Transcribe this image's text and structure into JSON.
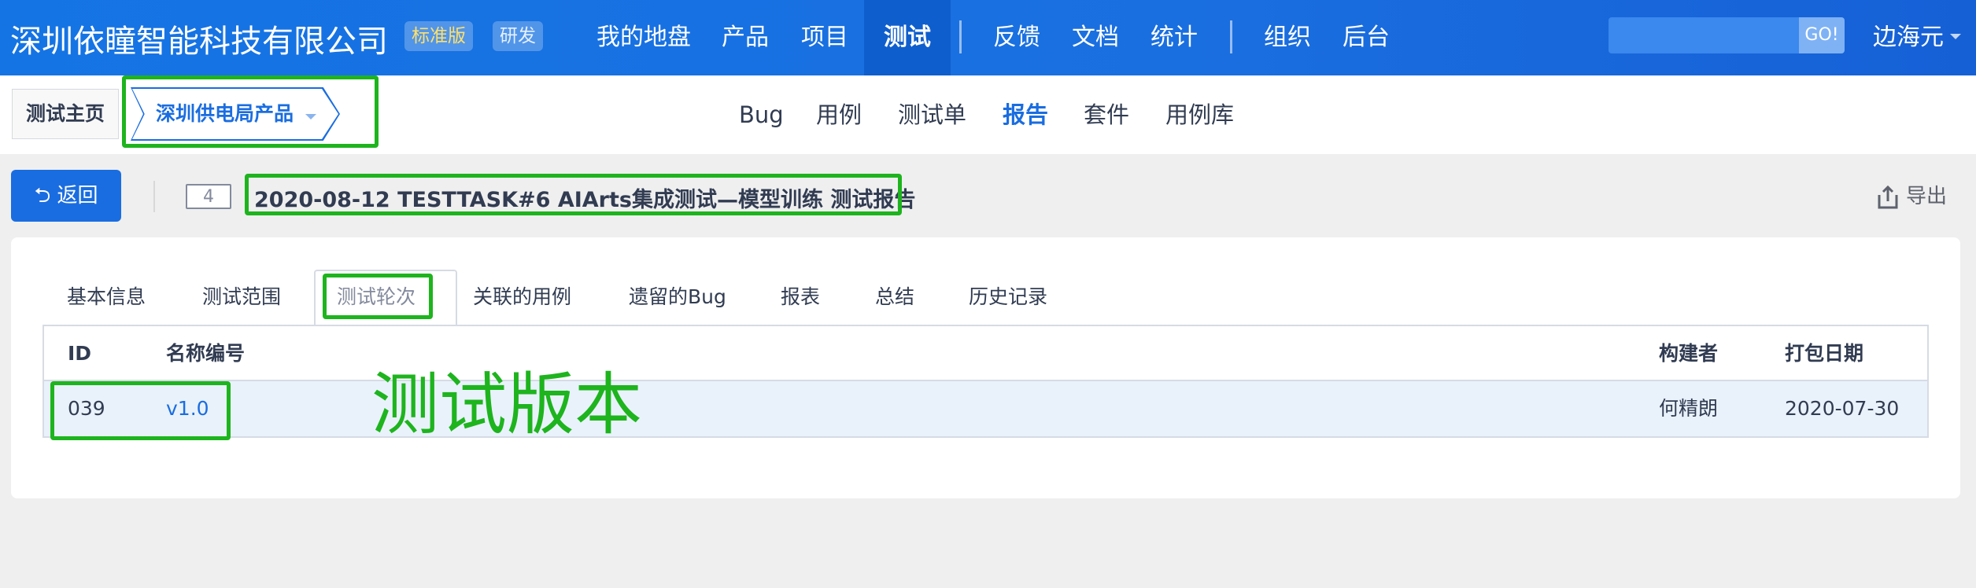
{
  "topbar": {
    "company": "深圳依瞳智能科技有限公司",
    "edition_tags": [
      "标准版",
      "研发"
    ],
    "nav_items": [
      "我的地盘",
      "产品",
      "项目",
      "测试",
      "反馈",
      "文档",
      "统计",
      "组织",
      "后台"
    ],
    "active_nav": "测试",
    "search_placeholder": "",
    "search_button": "GO!",
    "user": "边海元"
  },
  "subbar": {
    "home": "测试主页",
    "product": "深圳供电局产品",
    "items": [
      "Bug",
      "用例",
      "测试单",
      "报告",
      "套件",
      "用例库"
    ],
    "active_item": "报告"
  },
  "title_row": {
    "back_label": "返回",
    "report_id": "4",
    "report_title": "2020-08-12 TESTTASK#6 AIArts集成测试—模型训练 测试报告",
    "export_label": "导出"
  },
  "tabs": [
    "基本信息",
    "测试范围",
    "测试轮次",
    "关联的用例",
    "遗留的Bug",
    "报表",
    "总结",
    "历史记录"
  ],
  "active_tab": "测试轮次",
  "table": {
    "columns": [
      "ID",
      "名称编号",
      "构建者",
      "打包日期"
    ],
    "rows": [
      {
        "id": "039",
        "name": "v1.0",
        "builder": "何精朗",
        "date": "2020-07-30"
      }
    ]
  },
  "annotation": {
    "text": "测试版本",
    "color": "#1eb41e"
  },
  "colors": {
    "brand": "#1a6de0",
    "annotation": "#1eb41e",
    "row_highlight": "#e9f2fb"
  }
}
